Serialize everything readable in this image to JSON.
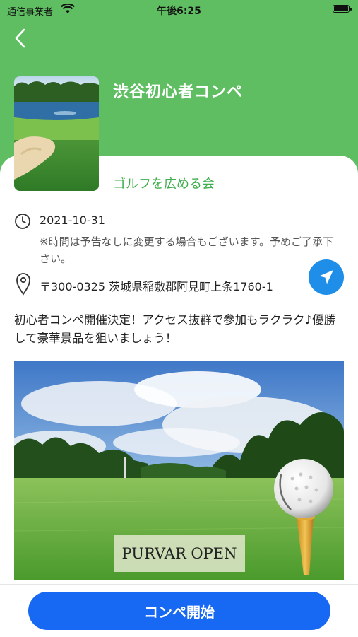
{
  "status_bar": {
    "carrier": "通信事業者",
    "time": "午後6:25"
  },
  "event": {
    "title": "渋谷初心者コンペ",
    "organizer": "ゴルフを広める会",
    "date": "2021-10-31",
    "notice": "※時間は予告なしに変更する場合もございます。予めご了承下さい。",
    "address": "〒300-0325 茨城県稲敷郡阿見町上条1760-1",
    "description": "初心者コンペ開催決定！アクセス抜群で参加もラクラク♪優勝して豪華景品を狙いましょう！",
    "photo_caption": "PURVAR OPEN"
  },
  "footer": {
    "start_label": "コンペ開始"
  },
  "colors": {
    "header_green": "#5fbe62",
    "accent_green": "#3fae4c",
    "primary_blue": "#1769f3",
    "nav_blue": "#1f8ee8"
  },
  "icons": [
    "back-chevron-icon",
    "wifi-icon",
    "battery-icon",
    "clock-icon",
    "location-pin-icon",
    "navigation-arrow-icon"
  ]
}
